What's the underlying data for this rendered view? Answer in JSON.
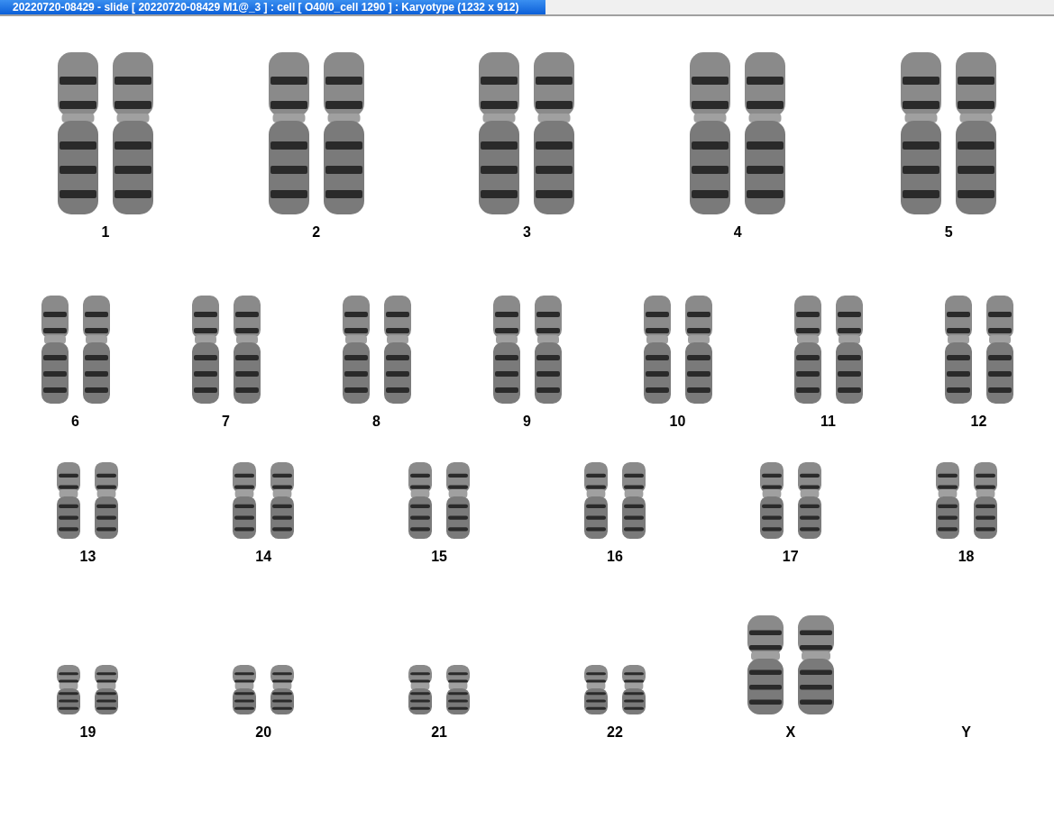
{
  "window": {
    "title": "20220720-08429 - slide [ 20220720-08429 M1@_3 ] : cell [ O40/0_cell 1290 ] : Karyotype  (1232 x 912)"
  },
  "karyotype": {
    "rows": [
      {
        "pairs": [
          {
            "label": "1",
            "kind": "autosome",
            "present": true
          },
          {
            "label": "2",
            "kind": "autosome",
            "present": true
          },
          {
            "label": "3",
            "kind": "autosome",
            "present": true
          },
          {
            "label": "4",
            "kind": "autosome",
            "present": true
          },
          {
            "label": "5",
            "kind": "autosome",
            "present": true
          }
        ]
      },
      {
        "pairs": [
          {
            "label": "6",
            "kind": "autosome",
            "present": true
          },
          {
            "label": "7",
            "kind": "autosome",
            "present": true
          },
          {
            "label": "8",
            "kind": "autosome",
            "present": true
          },
          {
            "label": "9",
            "kind": "autosome",
            "present": true
          },
          {
            "label": "10",
            "kind": "autosome",
            "present": true
          },
          {
            "label": "11",
            "kind": "autosome",
            "present": true
          },
          {
            "label": "12",
            "kind": "autosome",
            "present": true
          }
        ]
      },
      {
        "pairs": [
          {
            "label": "13",
            "kind": "autosome",
            "present": true
          },
          {
            "label": "14",
            "kind": "autosome",
            "present": true
          },
          {
            "label": "15",
            "kind": "autosome",
            "present": true
          },
          {
            "label": "16",
            "kind": "autosome",
            "present": true
          },
          {
            "label": "17",
            "kind": "autosome",
            "present": true
          },
          {
            "label": "18",
            "kind": "autosome",
            "present": true
          }
        ]
      },
      {
        "pairs": [
          {
            "label": "19",
            "kind": "autosome",
            "present": true
          },
          {
            "label": "20",
            "kind": "autosome",
            "present": true
          },
          {
            "label": "21",
            "kind": "autosome",
            "present": true
          },
          {
            "label": "22",
            "kind": "autosome",
            "present": true
          },
          {
            "label": "X",
            "kind": "sex",
            "present": true
          },
          {
            "label": "Y",
            "kind": "sex",
            "present": false
          }
        ]
      }
    ]
  }
}
